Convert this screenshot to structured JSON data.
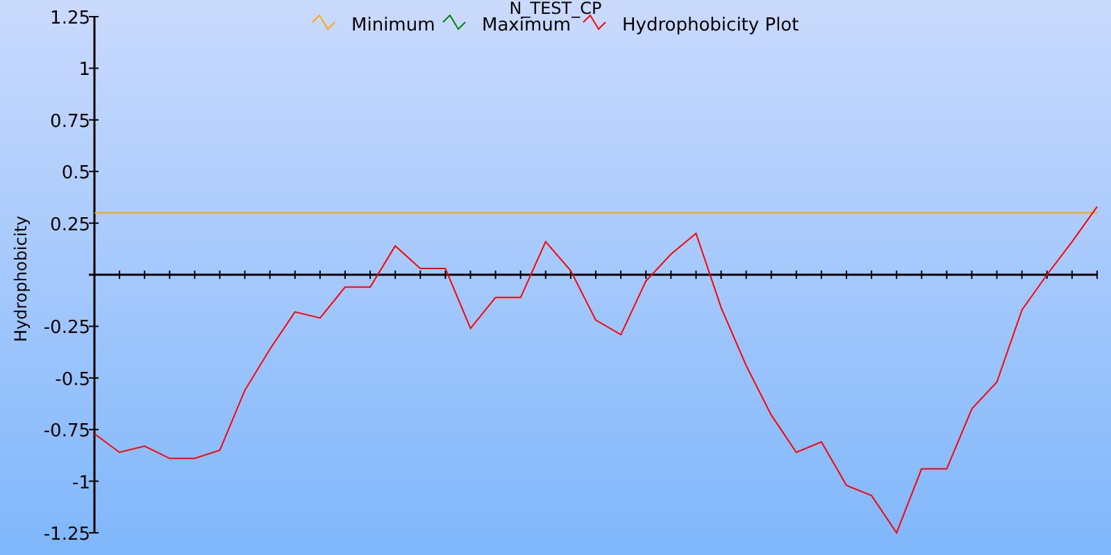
{
  "chart_data": {
    "type": "line",
    "title": "N_TEST_CP",
    "ylabel": "Hydrophobicity",
    "legend": true,
    "series": [
      {
        "name": "Minimum",
        "color": "#ffa500",
        "values": [
          0.3,
          0.3,
          0.3,
          0.3,
          0.3,
          0.3,
          0.3,
          0.3,
          0.3,
          0.3,
          0.3,
          0.3,
          0.3,
          0.3,
          0.3,
          0.3,
          0.3,
          0.3,
          0.3,
          0.3,
          0.3,
          0.3,
          0.3,
          0.3,
          0.3,
          0.3,
          0.3,
          0.3,
          0.3,
          0.3,
          0.3,
          0.3,
          0.3,
          0.3,
          0.3,
          0.3,
          0.3,
          0.3,
          0.3,
          0.3,
          0.3
        ]
      },
      {
        "name": "Maximum",
        "color": "#008000",
        "values": [
          null,
          null,
          null,
          null,
          null,
          null,
          null,
          null,
          null,
          null,
          null,
          null,
          null,
          null,
          null,
          null,
          null,
          null,
          null,
          null,
          null,
          null,
          null,
          null,
          null,
          null,
          null,
          null,
          null,
          null,
          null,
          null,
          null,
          null,
          null,
          null,
          null,
          null,
          null,
          null,
          null
        ]
      },
      {
        "name": "Hydrophobicity Plot",
        "color": "#ff0000",
        "values": [
          -0.77,
          -0.86,
          -0.83,
          -0.89,
          -0.89,
          -0.85,
          -0.56,
          -0.36,
          -0.18,
          -0.21,
          -0.06,
          -0.06,
          0.14,
          0.03,
          0.03,
          -0.26,
          -0.11,
          -0.11,
          0.16,
          0.02,
          -0.22,
          -0.29,
          -0.03,
          0.1,
          0.2,
          -0.16,
          -0.44,
          -0.68,
          -0.86,
          -0.81,
          -1.02,
          -1.07,
          -1.25,
          -0.94,
          -0.94,
          -0.65,
          -0.52,
          -0.17,
          0.0,
          0.16,
          0.33
        ]
      }
    ],
    "ylim": [
      -1.25,
      1.25
    ],
    "yticks": [
      1.25,
      1,
      0.75,
      0.5,
      0.25,
      -0.25,
      -0.5,
      -0.75,
      -1,
      -1.25
    ]
  }
}
